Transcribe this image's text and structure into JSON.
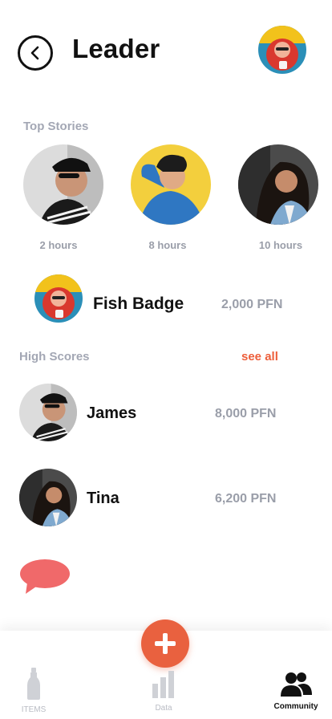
{
  "header": {
    "title": "Leader",
    "back_icon": "chevron-left-icon",
    "profile_avatar": "user-avatar-photo"
  },
  "top_stories": {
    "label": "Top Stories",
    "items": [
      {
        "time": "2 hours",
        "photo": "man-sunglasses-cap"
      },
      {
        "time": "8 hours",
        "photo": "person-yellow-background"
      },
      {
        "time": "10 hours",
        "photo": "woman-curly-hair"
      }
    ]
  },
  "badge": {
    "name": "Fish Badge",
    "amount": "2,000 PFN"
  },
  "high_scores": {
    "label": "High Scores",
    "see_all": "see all",
    "entries": [
      {
        "name": "James",
        "amount": "8,000 PFN"
      },
      {
        "name": "Tina",
        "amount": "6,200 PFN"
      }
    ]
  },
  "chat": {
    "icon": "chat-bubble-icon",
    "color": "#f0696a"
  },
  "fab": {
    "icon": "plus-icon",
    "color": "#e9613f"
  },
  "nav": {
    "items_label": "ITEMS",
    "data_label": "Data",
    "community_label": "Community"
  },
  "colors": {
    "accent": "#ed5e3a",
    "muted": "#9a9ea9"
  }
}
